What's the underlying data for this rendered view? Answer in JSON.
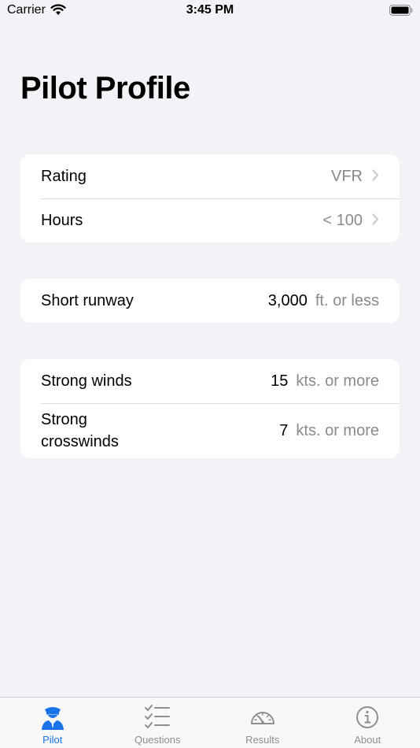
{
  "status": {
    "carrier": "Carrier",
    "time": "3:45 PM"
  },
  "page": {
    "title": "Pilot Profile"
  },
  "groups": {
    "profile": {
      "rating": {
        "label": "Rating",
        "value": "VFR"
      },
      "hours": {
        "label": "Hours",
        "value": "< 100"
      }
    },
    "runway": {
      "short_runway": {
        "label": "Short runway",
        "number": "3,000",
        "unit": "ft. or less"
      }
    },
    "winds": {
      "strong_winds": {
        "label": "Strong winds",
        "number": "15",
        "unit": "kts. or more"
      },
      "strong_crosswinds": {
        "label": "Strong\ncrosswinds",
        "number": "7",
        "unit": "kts. or more"
      }
    }
  },
  "tabs": [
    {
      "label": "Pilot",
      "icon": "pilot-icon",
      "active": true
    },
    {
      "label": "Questions",
      "icon": "checklist-icon",
      "active": false
    },
    {
      "label": "Results",
      "icon": "gauge-icon",
      "active": false
    },
    {
      "label": "About",
      "icon": "info-icon",
      "active": false
    }
  ],
  "colors": {
    "accent": "#1a73e8",
    "background": "#f2f2f7",
    "secondary_text": "#8a8a8e"
  }
}
